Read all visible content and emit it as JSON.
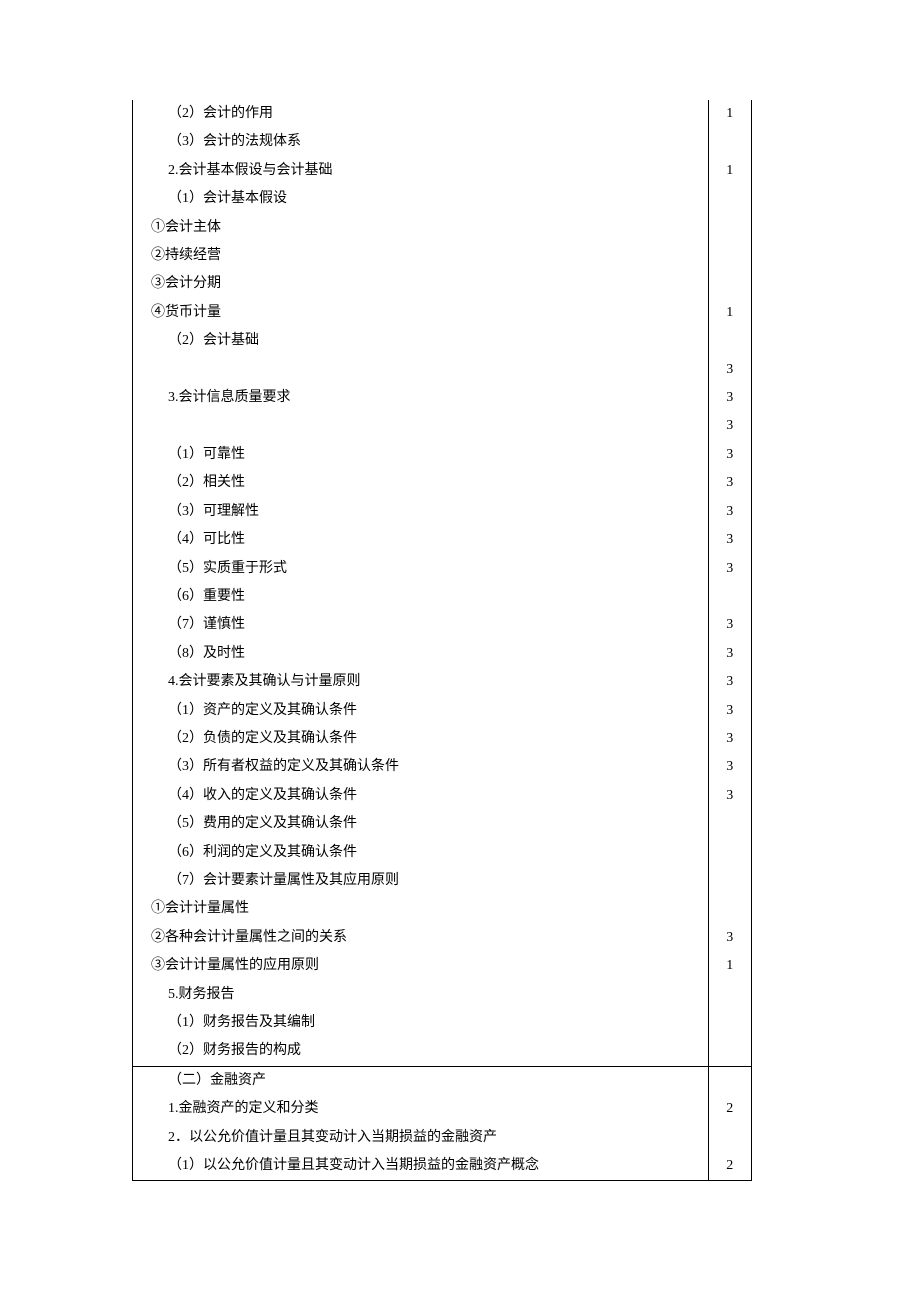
{
  "rows": [
    {
      "text": "（2）会计的作用",
      "val": "1",
      "indent": "lvl2"
    },
    {
      "text": "（3）会计的法规体系",
      "val": "",
      "indent": "lvl2"
    },
    {
      "text": "2.会计基本假设与会计基础",
      "val": "1",
      "indent": "lvl1"
    },
    {
      "text": "（1）会计基本假设",
      "val": "",
      "indent": "lvl2"
    },
    {
      "text": "①会计主体",
      "val": "",
      "indent": "lvl-sub"
    },
    {
      "text": "②持续经营",
      "val": "",
      "indent": "lvl-sub"
    },
    {
      "text": "③会计分期",
      "val": "",
      "indent": "lvl-sub"
    },
    {
      "text": "④货币计量",
      "val": "1",
      "indent": "lvl-sub"
    },
    {
      "text": "（2）会计基础",
      "val": "",
      "indent": "lvl2"
    },
    {
      "text": "",
      "val": "3",
      "indent": "lvl1"
    },
    {
      "text": "3.会计信息质量要求",
      "val": "3",
      "indent": "lvl1"
    },
    {
      "text": "",
      "val": "3",
      "indent": "lvl1"
    },
    {
      "text": "（1）可靠性",
      "val": "3",
      "indent": "lvl2"
    },
    {
      "text": "（2）相关性",
      "val": "3",
      "indent": "lvl2"
    },
    {
      "text": "（3）可理解性",
      "val": "3",
      "indent": "lvl2"
    },
    {
      "text": "（4）可比性",
      "val": "3",
      "indent": "lvl2"
    },
    {
      "text": "（5）实质重于形式",
      "val": "3",
      "indent": "lvl2"
    },
    {
      "text": "（6）重要性",
      "val": "",
      "indent": "lvl2"
    },
    {
      "text": "（7）谨慎性",
      "val": "3",
      "indent": "lvl2"
    },
    {
      "text": "（8）及时性",
      "val": "3",
      "indent": "lvl2"
    },
    {
      "text": "4.会计要素及其确认与计量原则",
      "val": "3",
      "indent": "lvl1"
    },
    {
      "text": "（1）资产的定义及其确认条件",
      "val": "3",
      "indent": "lvl2"
    },
    {
      "text": "（2）负债的定义及其确认条件",
      "val": "3",
      "indent": "lvl2"
    },
    {
      "text": "（3）所有者权益的定义及其确认条件",
      "val": "3",
      "indent": "lvl2"
    },
    {
      "text": "（4）收入的定义及其确认条件",
      "val": "3",
      "indent": "lvl2"
    },
    {
      "text": "（5）费用的定义及其确认条件",
      "val": "",
      "indent": "lvl2"
    },
    {
      "text": "（6）利润的定义及其确认条件",
      "val": "",
      "indent": "lvl2"
    },
    {
      "text": "（7）会计要素计量属性及其应用原则",
      "val": "",
      "indent": "lvl2"
    },
    {
      "text": "①会计计量属性",
      "val": "",
      "indent": "lvl-sub"
    },
    {
      "text": "②各种会计计量属性之间的关系",
      "val": "3",
      "indent": "lvl-sub"
    },
    {
      "text": "③会计计量属性的应用原则",
      "val": "1",
      "indent": "lvl-sub"
    },
    {
      "text": "5.财务报告",
      "val": "",
      "indent": "lvl1"
    },
    {
      "text": "（1）财务报告及其编制",
      "val": "",
      "indent": "lvl2"
    },
    {
      "text": "（2）财务报告的构成",
      "val": "",
      "indent": "lvl2"
    },
    {
      "text": "（二）金融资产",
      "val": "",
      "indent": "lvl2",
      "sectionStart": true
    },
    {
      "text": "1.金融资产的定义和分类",
      "val": "2",
      "indent": "lvl1"
    },
    {
      "text": "2．以公允价值计量且其变动计入当期损益的金融资产",
      "val": "",
      "indent": "lvl1"
    },
    {
      "text": "（1）以公允价值计量且其变动计入当期损益的金融资产概念",
      "val": "2",
      "indent": "lvl2",
      "lastRow": true
    }
  ]
}
